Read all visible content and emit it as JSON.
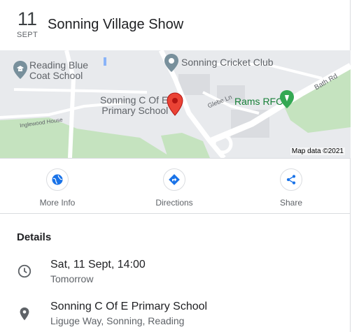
{
  "event": {
    "day": "11",
    "month": "SEPT",
    "title": "Sonning Village Show"
  },
  "map": {
    "labels": {
      "school_reading": "Reading Blue Coat School",
      "school_reading_line1": "Reading Blue",
      "school_reading_line2": "Coat School",
      "cricket_club": "Sonning Cricket Club",
      "primary_school_line1": "Sonning C Of E",
      "primary_school_line2": "Primary School",
      "rams": "Rams RFC",
      "glebe": "Glebe Ln",
      "bath": "Bath Rd",
      "inglewood": "Inglewood House"
    },
    "credit": "Map data ©2021",
    "colors": {
      "land": "#e8eaed",
      "park": "#c5e3bf",
      "road": "#ffffff",
      "pin_red": "#ea4335",
      "pin_gray": "#78909c",
      "pin_green": "#34a853"
    }
  },
  "actions": [
    {
      "label": "More Info",
      "icon": "globe-icon"
    },
    {
      "label": "Directions",
      "icon": "directions-icon"
    },
    {
      "label": "Share",
      "icon": "share-icon"
    }
  ],
  "details": {
    "heading": "Details",
    "time": {
      "primary": "Sat, 11 Sept, 14:00",
      "secondary": "Tomorrow",
      "icon": "clock-icon"
    },
    "location": {
      "primary": "Sonning C Of E Primary School",
      "secondary": "Liguge Way, Sonning, Reading",
      "icon": "location-pin-icon"
    }
  },
  "accent_color": "#1a73e8"
}
